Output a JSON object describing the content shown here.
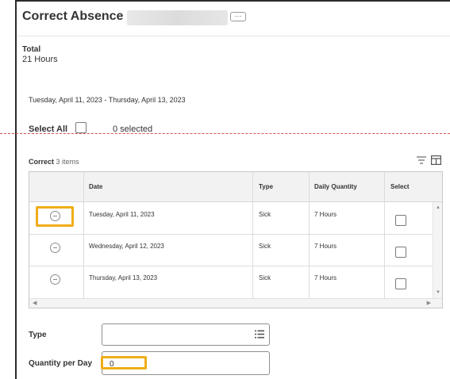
{
  "header": {
    "title": "Correct Absence",
    "more_label": "···"
  },
  "summary": {
    "total_label": "Total",
    "total_value": "21 Hours",
    "date_range": "Tuesday, April 11, 2023 - Thursday, April 13, 2023"
  },
  "select_all": {
    "label": "Select All",
    "count_text": "0 selected"
  },
  "grid": {
    "title": "Correct",
    "count": "3 items",
    "columns": [
      "Date",
      "Type",
      "Daily Quantity",
      "Select"
    ],
    "rows": [
      {
        "date": "Tuesday, April 11, 2023",
        "type": "Sick",
        "quantity": "7 Hours",
        "selected": false
      },
      {
        "date": "Wednesday, April 12, 2023",
        "type": "Sick",
        "quantity": "7 Hours",
        "selected": false
      },
      {
        "date": "Thursday, April 13, 2023",
        "type": "Sick",
        "quantity": "7 Hours",
        "selected": false
      }
    ]
  },
  "form": {
    "type_label": "Type",
    "type_value": "",
    "quantity_label": "Quantity per Day",
    "quantity_value": "0"
  },
  "icons": {
    "more": "ellipsis-icon",
    "filter": "filter-icon",
    "table_view": "table-view-icon",
    "remove": "remove-circle-icon",
    "list": "list-prompt-icon"
  },
  "colors": {
    "highlight": "#f0ad18",
    "frame": "#2b2b2b",
    "guide_line": "#d9534f"
  }
}
